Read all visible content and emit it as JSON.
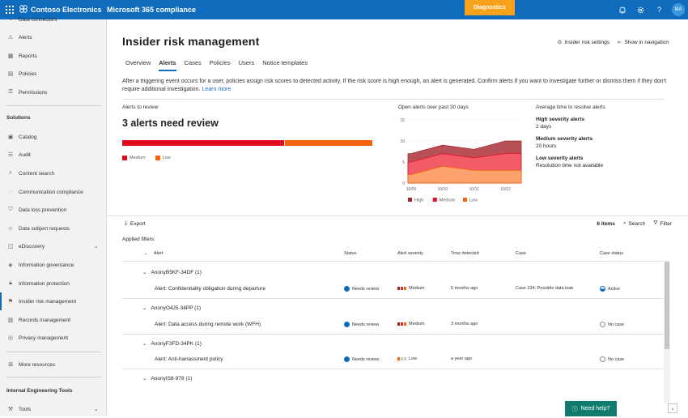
{
  "topbar": {
    "brand": "Contoso Electronics",
    "app": "Microsoft 365 compliance",
    "diagnostics": "Diagnostics",
    "avatar": "MA"
  },
  "sidebar": {
    "items": [
      {
        "label": "Data connectors",
        "icon": "connector-icon"
      },
      {
        "label": "Alerts",
        "icon": "alert-icon"
      },
      {
        "label": "Reports",
        "icon": "report-icon"
      },
      {
        "label": "Policies",
        "icon": "policy-icon"
      },
      {
        "label": "Permissions",
        "icon": "key-icon"
      }
    ],
    "solutions_heading": "Solutions",
    "solutions": [
      {
        "label": "Catalog",
        "icon": "catalog-icon"
      },
      {
        "label": "Audit",
        "icon": "audit-icon"
      },
      {
        "label": "Content search",
        "icon": "search-icon"
      },
      {
        "label": "Communication compliance",
        "icon": "chat-icon"
      },
      {
        "label": "Data loss prevention",
        "icon": "shield-icon"
      },
      {
        "label": "Data subject requests",
        "icon": "person-icon"
      },
      {
        "label": "eDiscovery",
        "icon": "ediscovery-icon"
      },
      {
        "label": "Information governance",
        "icon": "governance-icon"
      },
      {
        "label": "Information protection",
        "icon": "lock-icon"
      },
      {
        "label": "Insider risk management",
        "icon": "insider-icon"
      },
      {
        "label": "Records management",
        "icon": "records-icon"
      },
      {
        "label": "Privacy management",
        "icon": "privacy-icon"
      }
    ],
    "more": "More resources",
    "internal_heading": "Internal Engineering Tools",
    "tools": "Tools"
  },
  "page": {
    "title": "Insider risk management",
    "settings": "Insider risk settings",
    "show_nav": "Show in navigation",
    "tabs": [
      "Overview",
      "Alerts",
      "Cases",
      "Policies",
      "Users",
      "Notice templates"
    ],
    "description": "After a triggering event occurs for a user, policies assign risk scores to detected activity. If the risk score is high enough, an alert is generated. Confirm alerts if you want to investigate further or dismiss them if they don't require additional investigation.",
    "learn_more": "Learn more"
  },
  "review": {
    "title": "Alerts to review",
    "count": "3 alerts need review",
    "legend": [
      "Medium",
      "Low"
    ],
    "colors": {
      "high": "#a4262c",
      "medium": "#d13438",
      "low": "#f7630c"
    },
    "medium_fraction": 0.65
  },
  "chart_data": {
    "type": "area",
    "title": "Open alerts over past 30 days",
    "x": [
      "10/09",
      "10/10",
      "10/11",
      "10/12"
    ],
    "yticks": [
      "15",
      "10",
      "5",
      "0"
    ],
    "ylim": [
      0,
      15
    ],
    "series": [
      {
        "name": "High",
        "values": [
          7,
          9,
          8,
          10
        ]
      },
      {
        "name": "Medium",
        "values": [
          5,
          7,
          6,
          7
        ]
      },
      {
        "name": "Low",
        "values": [
          2,
          4,
          3,
          3
        ]
      }
    ]
  },
  "avg": {
    "title": "Average time to resolve alerts",
    "items": [
      {
        "label": "High severity alerts",
        "value": "2 days"
      },
      {
        "label": "Medium severity alerts",
        "value": "20 hours"
      },
      {
        "label": "Low severity alerts",
        "value": "Resolution time not available"
      }
    ]
  },
  "toolbar": {
    "export": "Export",
    "count": "6 items",
    "search": "Search",
    "filter": "Filter",
    "applied": "Applied filters:"
  },
  "table": {
    "headers": [
      "Alert",
      "Status",
      "Alert severity",
      "Time detected",
      "Case",
      "Case status"
    ],
    "groups": [
      {
        "name": "AnonyB5KF-34DF (1)",
        "alert": "Alert: Confidentiality obligation during departure",
        "status": "Needs review",
        "severity": "Medium",
        "time": "6 months ago",
        "case": "Case 234: Possible data leak",
        "case_status": "Active"
      },
      {
        "name": "AnonyO4J5-34PP (1)",
        "alert": "Alert: Data access during remote work (WFH)",
        "status": "Needs review",
        "severity": "Medium",
        "time": "3 months ago",
        "case": "",
        "case_status": "No case"
      },
      {
        "name": "AnonyF3FD-34PK (1)",
        "alert": "Alert: Anti-harrassment policy",
        "status": "Needs review",
        "severity": "Low",
        "time": "a year ago",
        "case": "",
        "case_status": "No case"
      },
      {
        "name": "AnonyIS8-978 (1)"
      }
    ]
  },
  "help": "Need help?"
}
